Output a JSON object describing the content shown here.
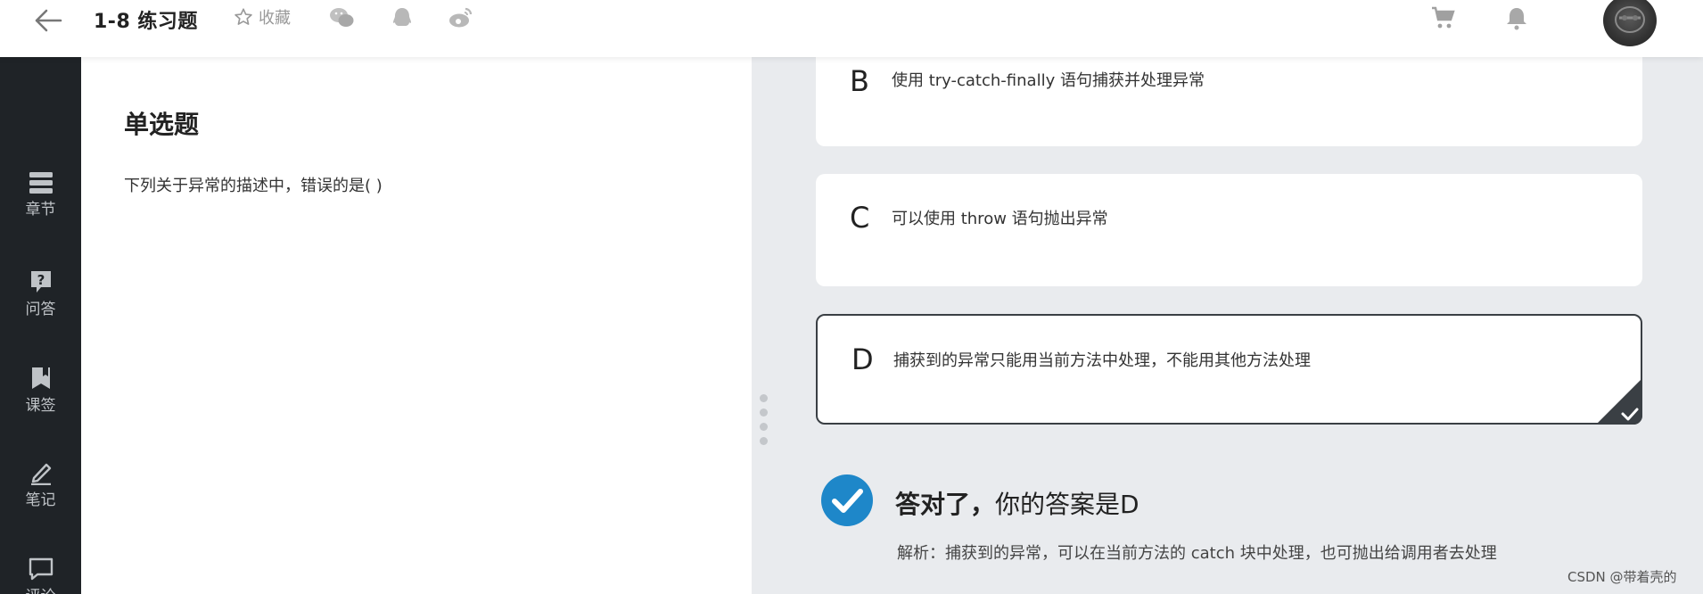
{
  "header": {
    "title": "1-8 练习题",
    "favorite_label": "收藏",
    "share_icons": [
      "wechat-icon",
      "qq-icon",
      "weibo-icon"
    ]
  },
  "rail": {
    "items": [
      {
        "label": "章节",
        "icon": "list-icon"
      },
      {
        "label": "问答",
        "icon": "question-icon"
      },
      {
        "label": "课签",
        "icon": "bookmark-icon"
      },
      {
        "label": "笔记",
        "icon": "pencil-icon"
      },
      {
        "label": "评论",
        "icon": "comment-icon"
      }
    ]
  },
  "question": {
    "type": "单选题",
    "text": "下列关于异常的描述中，错误的是( )"
  },
  "options": [
    {
      "letter": "B",
      "text": "使用 try-catch-finally 语句捕获并处理异常"
    },
    {
      "letter": "C",
      "text": "可以使用 throw 语句抛出异常"
    },
    {
      "letter": "D",
      "text": "捕获到的异常只能用当前方法中处理，不能用其他方法处理",
      "selected": true
    }
  ],
  "result": {
    "status": "答对了",
    "answer_text": "你的答案是D",
    "analysis": "解析：捕获到的异常，可以在当前方法的 catch 块中处理，也可抛出给调用者去处理"
  },
  "watermark": "CSDN @带着壳的",
  "colors": {
    "accent": "#1e87c9",
    "rail_bg": "#1f2327",
    "selected_border": "#3a3f44"
  }
}
